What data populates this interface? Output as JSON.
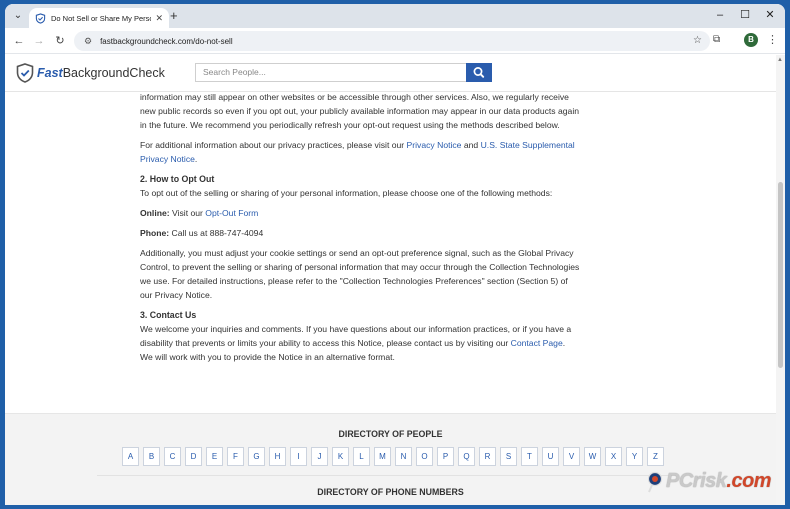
{
  "browser": {
    "tab_title": "Do Not Sell or Share My Person",
    "url": "fastbackgroundcheck.com/do-not-sell",
    "profile_initial": "B"
  },
  "header": {
    "brand_fast": "Fast",
    "brand_rest": "BackgroundCheck",
    "search_placeholder": "Search People..."
  },
  "content": {
    "p1": "information may still appear on other websites or be accessible through other services. Also, we regularly receive new public records so even if you opt out, your publicly available information may appear in our data products again in the future. We recommend you periodically refresh your opt-out request using the methods described below.",
    "p2_pre": "For additional information about our privacy practices, please visit our ",
    "p2_link1": "Privacy Notice",
    "p2_mid": " and ",
    "p2_link2": "U.S. State Supplemental Privacy Notice",
    "p2_post": ".",
    "h2": "2. How to Opt Out",
    "p3": "To opt out of the selling or sharing of your personal information, please choose one of the following methods:",
    "online_label": "Online:",
    "online_text": " Visit our ",
    "online_link": "Opt-Out Form",
    "phone_label": "Phone:",
    "phone_text": " Call us at 888-747-4094",
    "p4": "Additionally, you must adjust your cookie settings or send an opt-out preference signal, such as the Global Privacy Control, to prevent the selling or sharing of personal information that may occur through the Collection Technologies we use. For detailed instructions, please refer to the \"Collection Technologies Preferences\" section (Section 5) of our Privacy Notice.",
    "h3": "3. Contact Us",
    "p5_pre": "We welcome your inquiries and comments. If you have questions about our information practices, or if you have a disability that prevents or limits your ability to access this Notice, please contact us by visiting our ",
    "p5_link": "Contact Page",
    "p5_post": ". We will work with you to provide the Notice in an alternative format."
  },
  "footer": {
    "dir_people": "DIRECTORY OF PEOPLE",
    "dir_phone": "DIRECTORY OF PHONE NUMBERS",
    "letters": [
      "A",
      "B",
      "C",
      "D",
      "E",
      "F",
      "G",
      "H",
      "I",
      "J",
      "K",
      "L",
      "M",
      "N",
      "O",
      "P",
      "Q",
      "R",
      "S",
      "T",
      "U",
      "V",
      "W",
      "X",
      "Y",
      "Z"
    ]
  },
  "watermark": {
    "text_main": "PC",
    "text_tail": "risk",
    "text_dot": ".com"
  },
  "colors": {
    "link": "#2a5cad",
    "brand": "#2a5cad"
  }
}
